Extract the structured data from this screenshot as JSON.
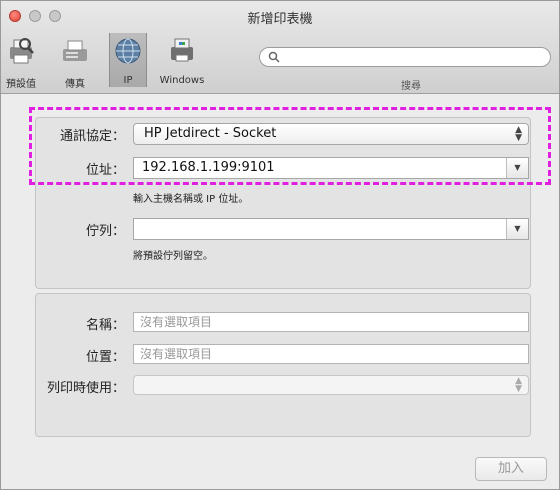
{
  "window": {
    "title": "新增印表機"
  },
  "toolbar": {
    "items": [
      {
        "label": "預設值",
        "icon": "default-printer-icon"
      },
      {
        "label": "傳真",
        "icon": "fax-icon"
      },
      {
        "label": "IP",
        "icon": "ip-globe-icon",
        "selected": true
      },
      {
        "label": "Windows",
        "icon": "windows-printer-icon"
      }
    ],
    "search_label": "搜尋"
  },
  "connection": {
    "protocol_label": "通訊協定：",
    "protocol_value": "HP Jetdirect - Socket",
    "address_label": "位址：",
    "address_value": "192.168.1.199:9101",
    "address_hint": "輸入主機名稱或 IP 位址。",
    "queue_label": "佇列：",
    "queue_value": "",
    "queue_hint": "將預設佇列留空。"
  },
  "info": {
    "name_label": "名稱：",
    "name_placeholder": "沒有選取項目",
    "location_label": "位置：",
    "location_placeholder": "沒有選取項目",
    "use_label": "列印時使用："
  },
  "footer": {
    "add_label": "加入"
  },
  "colors": {
    "highlight": "#e020e0",
    "close_button": "#e0453a"
  }
}
